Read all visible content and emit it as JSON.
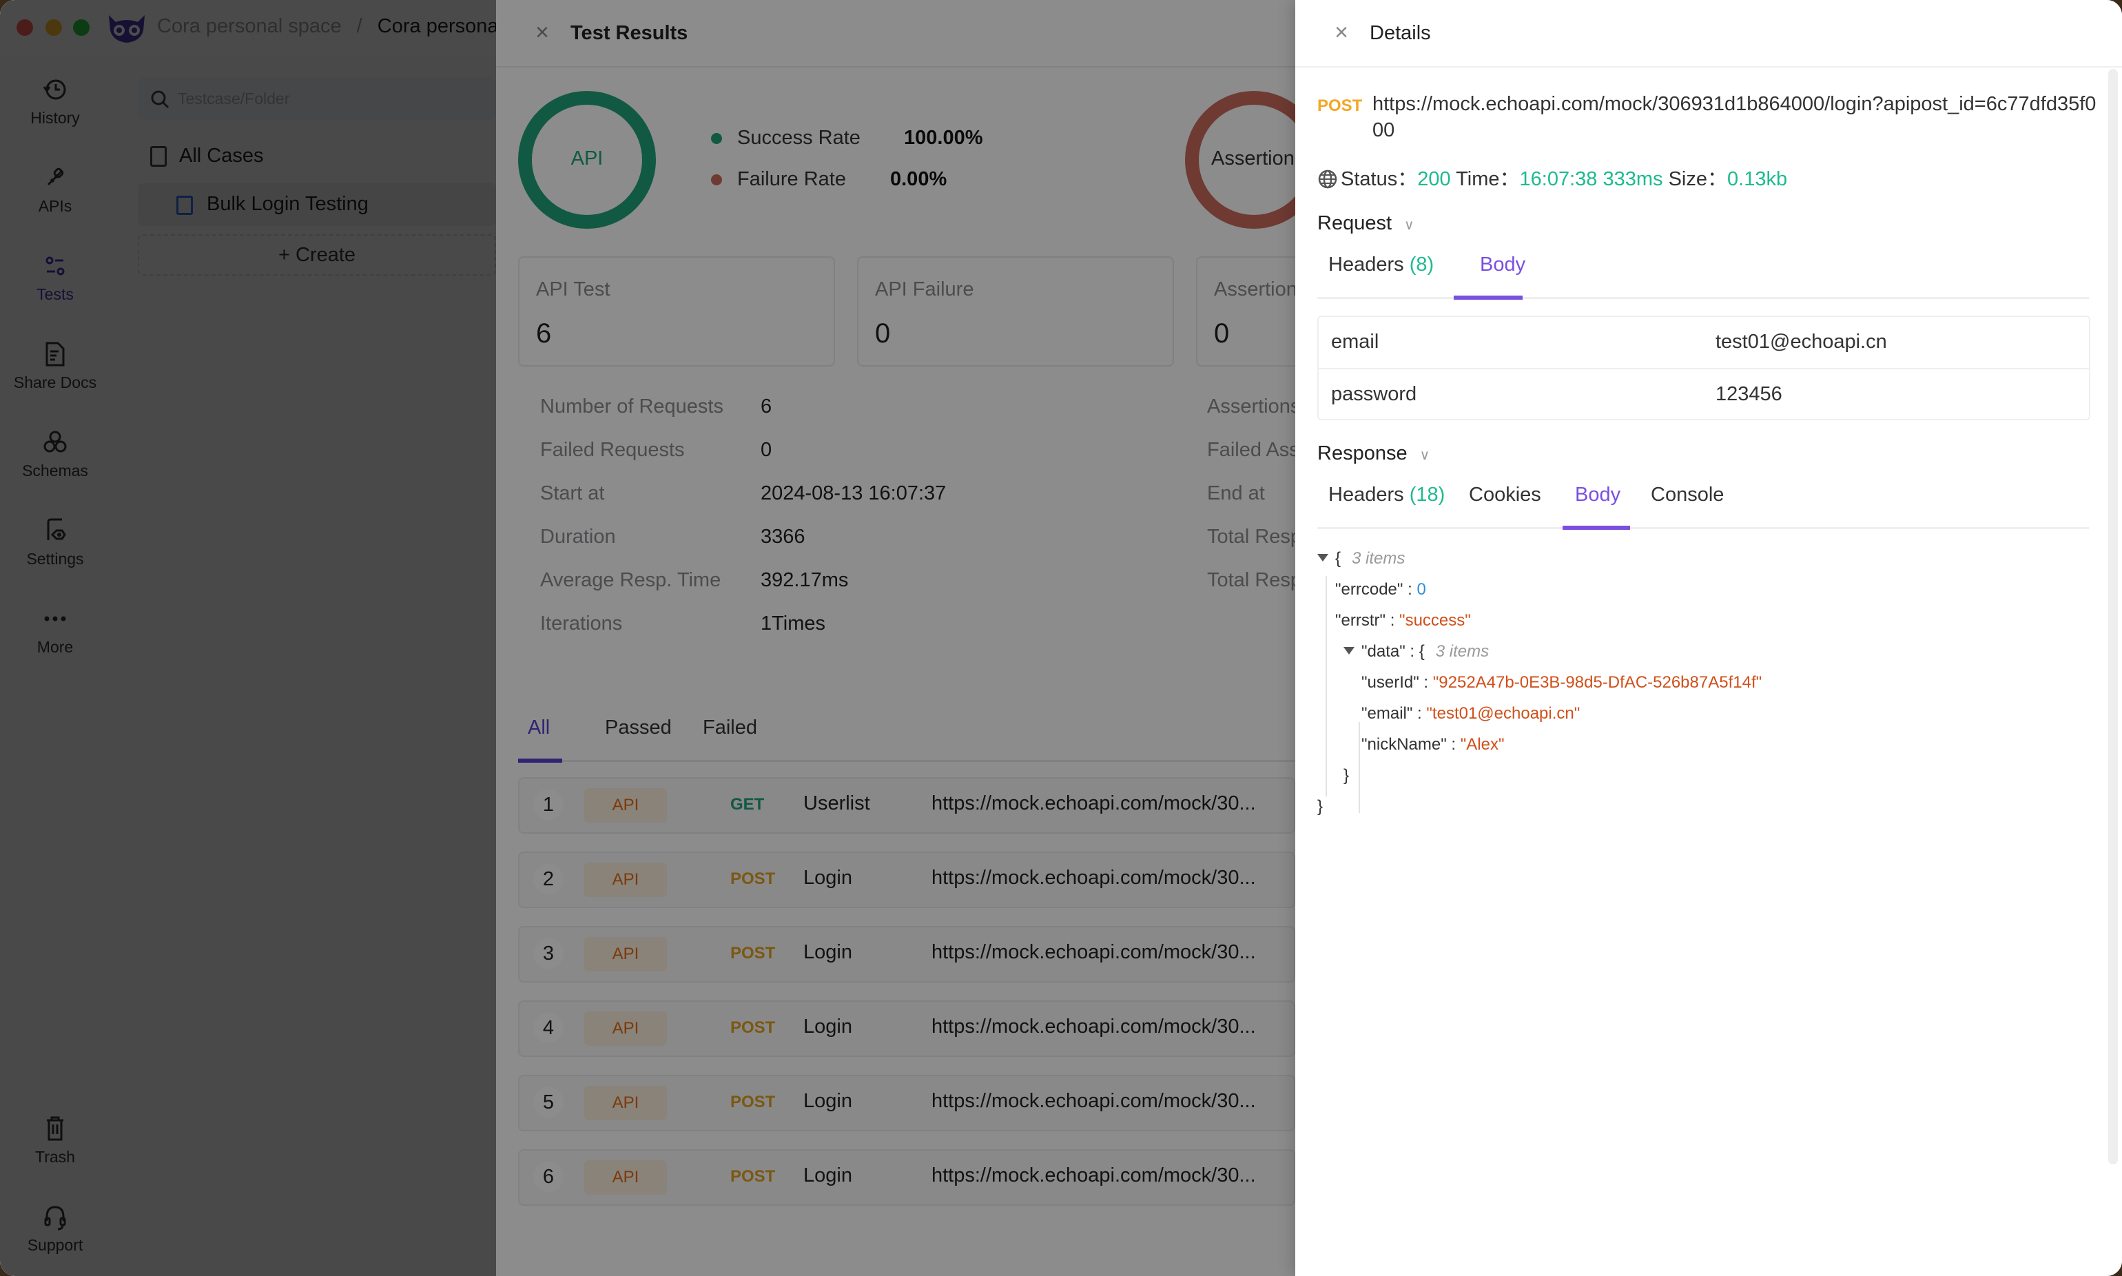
{
  "window": {
    "traffic_lights": {
      "close": "#ff5f57",
      "minimize": "#febc2e",
      "maximize": "#28c840"
    },
    "breadcrumb": [
      "Cora personal space",
      "Cora persona"
    ]
  },
  "nav": {
    "items": [
      {
        "label": "History",
        "icon": "history-icon"
      },
      {
        "label": "APIs",
        "icon": "api-plug-icon"
      },
      {
        "label": "Tests",
        "icon": "tests-icon",
        "active": true
      },
      {
        "label": "Share Docs",
        "icon": "share-docs-icon"
      },
      {
        "label": "Schemas",
        "icon": "schemas-icon"
      },
      {
        "label": "Settings",
        "icon": "settings-icon"
      },
      {
        "label": "More",
        "icon": "more-icon"
      }
    ],
    "bottom": [
      {
        "label": "Trash",
        "icon": "trash-icon"
      },
      {
        "label": "Support",
        "icon": "headset-icon"
      }
    ]
  },
  "testcase_panel": {
    "search_placeholder": "Testcase/Folder",
    "all_cases": "All Cases",
    "selected_case": "Bulk Login Testing",
    "create_label": "Create"
  },
  "test_results": {
    "title": "Test Results",
    "api_ring_label": "API",
    "assertion_ring_label": "Assertion",
    "success_rate_label": "Success Rate",
    "success_rate": "100.00%",
    "failure_rate_label": "Failure Rate",
    "failure_rate": "0.00%",
    "cards": [
      {
        "label": "API Test",
        "value": "6"
      },
      {
        "label": "API Failure",
        "value": "0"
      },
      {
        "label": "Assertion",
        "value": "0"
      }
    ],
    "stats": [
      {
        "label": "Number of Requests",
        "value": "6"
      },
      {
        "label": "Failed Requests",
        "value": "0"
      },
      {
        "label": "Start at",
        "value": "2024-08-13 16:07:37"
      },
      {
        "label": "Duration",
        "value": "3366"
      },
      {
        "label": "Average Resp. Time",
        "value": "392.17ms"
      },
      {
        "label": "Iterations",
        "value": "1Times"
      }
    ],
    "stats_right_labels": [
      "Assertions",
      "Failed Ass",
      "End at",
      "Total Resp",
      "Total Resp"
    ],
    "filter_tabs": [
      "All",
      "Passed",
      "Failed"
    ],
    "active_filter": "All",
    "rows": [
      {
        "index": "1",
        "type": "API",
        "method": "GET",
        "name": "Userlist",
        "url": "https://mock.echoapi.com/mock/30..."
      },
      {
        "index": "2",
        "type": "API",
        "method": "POST",
        "name": "Login",
        "url": "https://mock.echoapi.com/mock/30..."
      },
      {
        "index": "3",
        "type": "API",
        "method": "POST",
        "name": "Login",
        "url": "https://mock.echoapi.com/mock/30..."
      },
      {
        "index": "4",
        "type": "API",
        "method": "POST",
        "name": "Login",
        "url": "https://mock.echoapi.com/mock/30..."
      },
      {
        "index": "5",
        "type": "API",
        "method": "POST",
        "name": "Login",
        "url": "https://mock.echoapi.com/mock/30..."
      },
      {
        "index": "6",
        "type": "API",
        "method": "POST",
        "name": "Login",
        "url": "https://mock.echoapi.com/mock/30..."
      }
    ],
    "method_colors": {
      "GET": "#1fa27a",
      "POST": "#e0a020"
    }
  },
  "details": {
    "title": "Details",
    "method": "POST",
    "url": "https://mock.echoapi.com/mock/306931d1b864000/login?apipost_id=6c77dfd35f000",
    "status_label": "Status：",
    "status": "200",
    "time_label": "Time：",
    "time": "16:07:38",
    "duration": "333ms",
    "size_label": "Size：",
    "size": "0.13kb",
    "request": {
      "label": "Request",
      "tabs": [
        {
          "label": "Headers",
          "count": "(8)"
        },
        {
          "label": "Body"
        }
      ],
      "active_tab": "Body",
      "body": [
        {
          "key": "email",
          "value": "test01@echoapi.cn"
        },
        {
          "key": "password",
          "value": "123456"
        }
      ]
    },
    "response": {
      "label": "Response",
      "tabs": [
        {
          "label": "Headers",
          "count": "(18)"
        },
        {
          "label": "Cookies"
        },
        {
          "label": "Body"
        },
        {
          "label": "Console"
        }
      ],
      "active_tab": "Body",
      "json": {
        "root_items": "3 items",
        "errcode_key": "\"errcode\"",
        "errcode": "0",
        "errstr_key": "\"errstr\"",
        "errstr": "\"success\"",
        "data_key": "\"data\"",
        "data_items": "3 items",
        "userId_key": "\"userId\"",
        "userId": "\"9252A47b-0E3B-98d5-DfAC-526b87A5f14f\"",
        "email_key": "\"email\"",
        "email": "\"test01@echoapi.cn\"",
        "nickName_key": "\"nickName\"",
        "nickName": "\"Alex\""
      }
    }
  },
  "colors": {
    "accent": "#7a4fe0",
    "success": "#1fa27a",
    "failure": "#c96a5b",
    "post": "#f5a623"
  }
}
